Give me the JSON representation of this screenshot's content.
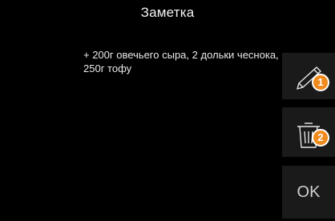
{
  "header": {
    "title": "Заметка"
  },
  "note": {
    "text": "+ 200г овечьего сыра, 2 дольки чеснока, 250г тофу"
  },
  "buttons": {
    "edit_icon": "pencil-icon",
    "delete_icon": "trash-icon",
    "ok_label": "OK"
  },
  "annotations": {
    "badge_1": "1",
    "badge_2": "2"
  },
  "colors": {
    "background": "#000000",
    "button_bg": "#1a1a1a",
    "badge": "#f08a1c"
  }
}
